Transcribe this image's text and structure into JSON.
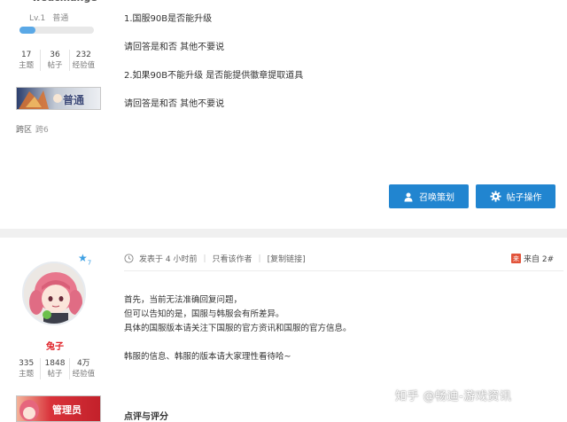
{
  "post1": {
    "username": "woacmange",
    "level": "Lv.1",
    "rank": "普通",
    "exp_progress": 0.22,
    "stats": [
      {
        "value": "17",
        "label": "主题"
      },
      {
        "value": "36",
        "label": "帖子"
      },
      {
        "value": "232",
        "label": "经验值"
      }
    ],
    "badge_text": "普通",
    "cross_region_label": "跨区",
    "cross_region_value": "跨6",
    "lines": [
      "1.国服90B是否能升级",
      "请回答是和否 其他不要说",
      "2.如果90B不能升级 是否能提供徽章提取道具",
      "请回答是和否 其他不要说"
    ],
    "buttons": {
      "summon": "召唤策划",
      "thread_ops": "帖子操作"
    }
  },
  "post2": {
    "badge_star": "7",
    "username": "兔子",
    "stats": [
      {
        "value": "335",
        "label": "主题"
      },
      {
        "value": "1848",
        "label": "帖子"
      },
      {
        "value": "4万",
        "label": "经验值"
      }
    ],
    "role_badge": "管理员",
    "meta": {
      "posted": "发表于 4 小时前",
      "only_author": "只看该作者",
      "copy_link": "[复制链接]"
    },
    "floor": "来自 2#",
    "lines": [
      "首先，当前无法准确回复问题，",
      "但可以告知的是，国服与韩服会有所差异。",
      "具体的国服版本请关注下国服的官方资讯和国服的官方信息。",
      "韩服的信息、韩服的版本请大家理性看待哈~"
    ],
    "review_title": "点评与评分"
  },
  "watermark": "知乎 @畅迪-游戏资讯",
  "colors": {
    "accent": "#2185d0",
    "username_red": "#e0242a",
    "divider": "#f0f0f0"
  }
}
